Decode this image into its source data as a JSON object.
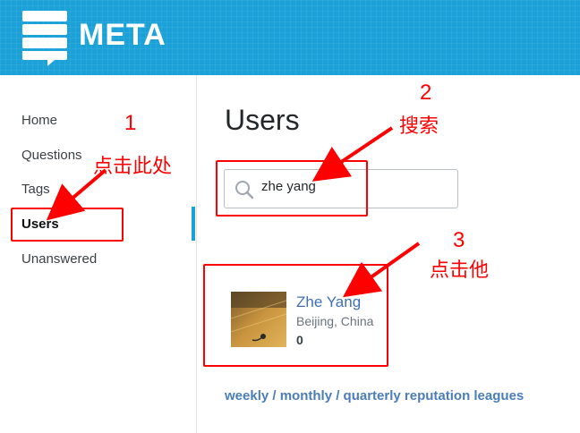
{
  "header": {
    "logo_text": "META"
  },
  "sidebar": {
    "items": [
      {
        "label": "Home"
      },
      {
        "label": "Questions"
      },
      {
        "label": "Tags"
      },
      {
        "label": "Users"
      },
      {
        "label": "Unanswered"
      }
    ],
    "active": "Users"
  },
  "main": {
    "title": "Users",
    "search": {
      "value": "zhe yang"
    },
    "user": {
      "name": "Zhe Yang",
      "location": "Beijing, China",
      "reputation": "0"
    },
    "leagues_link": "weekly / monthly / quarterly reputation leagues"
  },
  "annotations": [
    {
      "number": "1",
      "text": "点击此处"
    },
    {
      "number": "2",
      "text": "搜索"
    },
    {
      "number": "3",
      "text": "点击他"
    }
  ],
  "colors": {
    "brand": "#1ba1d8",
    "annotation": "#ff0000",
    "link": "#3f6fb6"
  }
}
